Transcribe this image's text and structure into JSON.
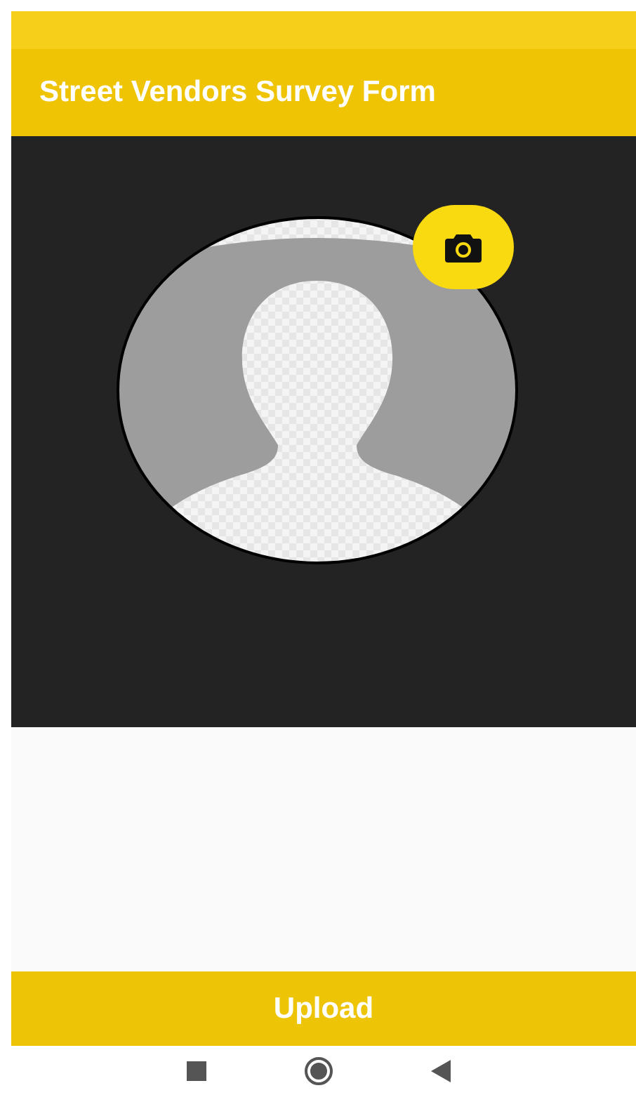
{
  "app_bar": {
    "title": "Street Vendors Survey Form"
  },
  "profile_photo": {
    "kind": "placeholder"
  },
  "upload_button": {
    "label": "Upload"
  }
}
